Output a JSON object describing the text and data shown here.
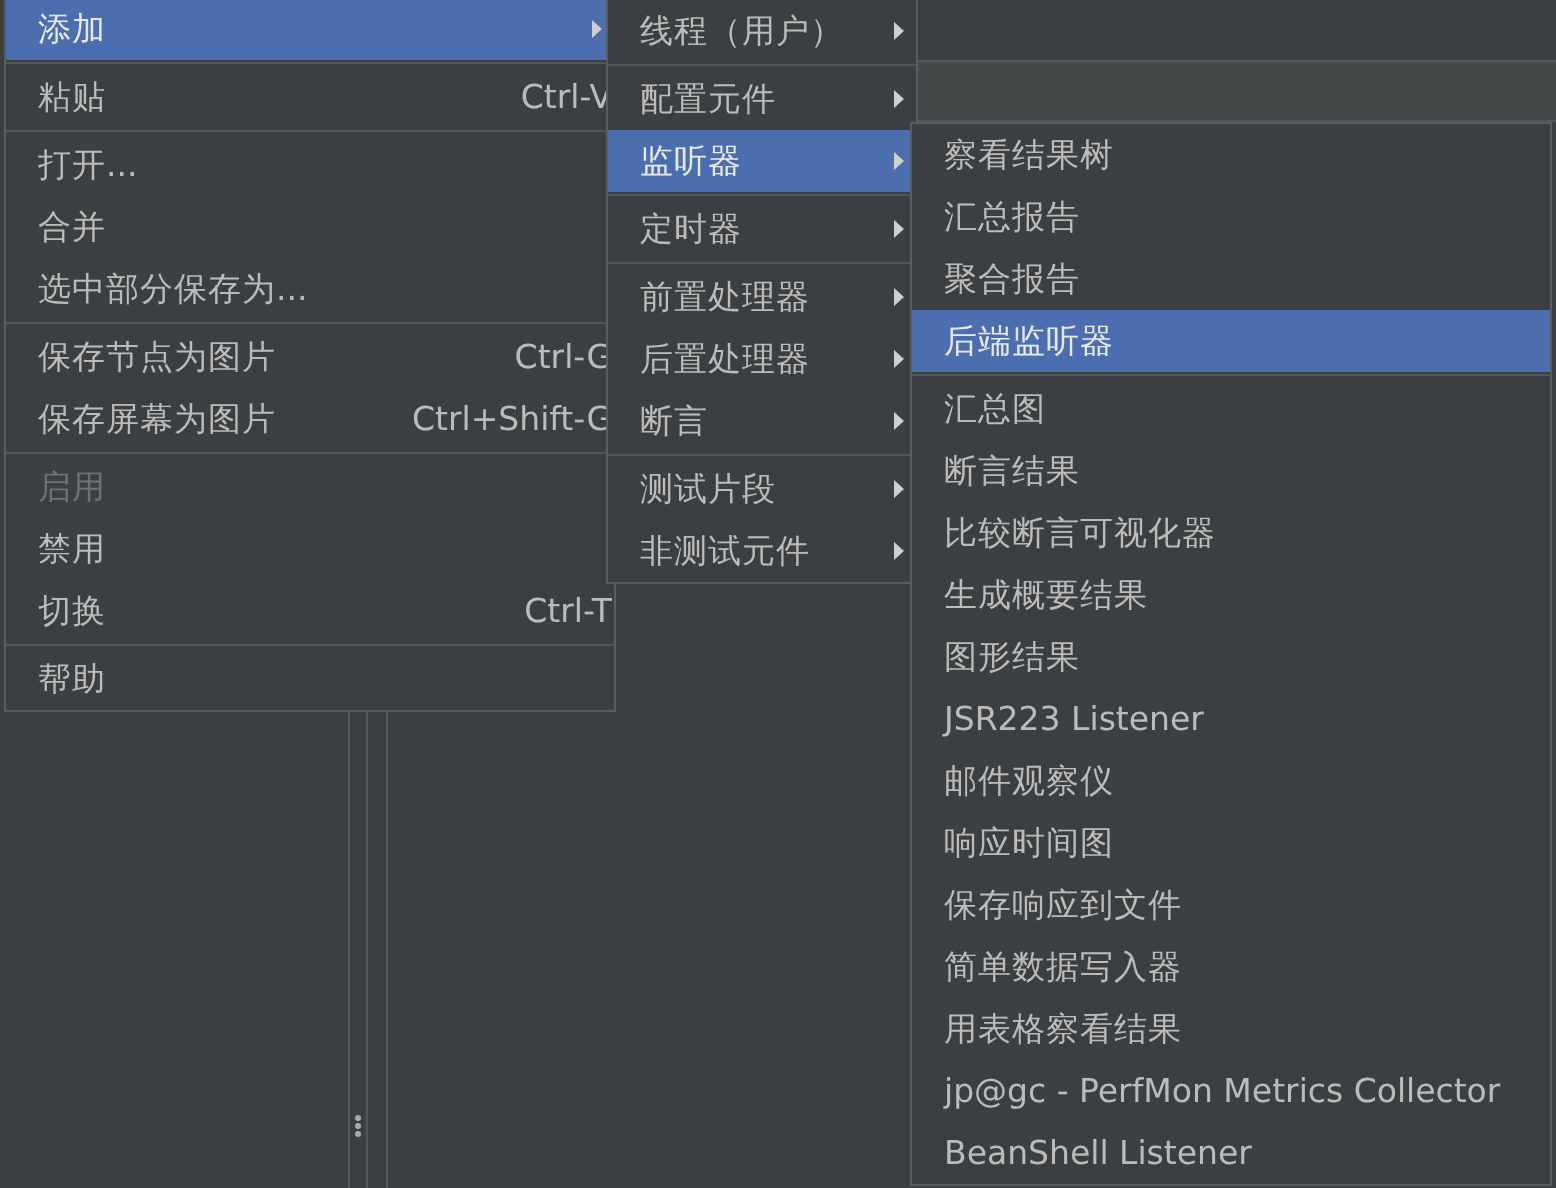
{
  "menus": [
    {
      "groups": [
        [
          {
            "label": "添加",
            "has_submenu": true,
            "selected": true,
            "disabled": false
          }
        ],
        [
          {
            "label": "粘贴",
            "shortcut": "Ctrl-V",
            "has_submenu": false,
            "selected": false,
            "disabled": false
          }
        ],
        [
          {
            "label": "打开...",
            "has_submenu": false,
            "selected": false,
            "disabled": false
          },
          {
            "label": "合并",
            "has_submenu": false,
            "selected": false,
            "disabled": false
          },
          {
            "label": "选中部分保存为...",
            "has_submenu": false,
            "selected": false,
            "disabled": false
          }
        ],
        [
          {
            "label": "保存节点为图片",
            "shortcut": "Ctrl-G",
            "has_submenu": false,
            "selected": false,
            "disabled": false
          },
          {
            "label": "保存屏幕为图片",
            "shortcut": "Ctrl+Shift-G",
            "has_submenu": false,
            "selected": false,
            "disabled": false
          }
        ],
        [
          {
            "label": "启用",
            "has_submenu": false,
            "selected": false,
            "disabled": true
          },
          {
            "label": "禁用",
            "has_submenu": false,
            "selected": false,
            "disabled": false
          },
          {
            "label": "切换",
            "shortcut": "Ctrl-T",
            "has_submenu": false,
            "selected": false,
            "disabled": false
          }
        ],
        [
          {
            "label": "帮助",
            "has_submenu": false,
            "selected": false,
            "disabled": false
          }
        ]
      ]
    },
    {
      "groups": [
        [
          {
            "label": "线程（用户）",
            "has_submenu": true,
            "selected": false
          }
        ],
        [
          {
            "label": "配置元件",
            "has_submenu": true,
            "selected": false
          },
          {
            "label": "监听器",
            "has_submenu": true,
            "selected": true
          }
        ],
        [
          {
            "label": "定时器",
            "has_submenu": true,
            "selected": false
          }
        ],
        [
          {
            "label": "前置处理器",
            "has_submenu": true,
            "selected": false
          },
          {
            "label": "后置处理器",
            "has_submenu": true,
            "selected": false
          },
          {
            "label": "断言",
            "has_submenu": true,
            "selected": false
          }
        ],
        [
          {
            "label": "测试片段",
            "has_submenu": true,
            "selected": false
          },
          {
            "label": "非测试元件",
            "has_submenu": true,
            "selected": false
          }
        ]
      ]
    },
    {
      "groups": [
        [
          {
            "label": "察看结果树",
            "selected": false
          },
          {
            "label": "汇总报告",
            "selected": false
          },
          {
            "label": "聚合报告",
            "selected": false
          },
          {
            "label": "后端监听器",
            "selected": true
          }
        ],
        [
          {
            "label": "汇总图",
            "selected": false
          },
          {
            "label": "断言结果",
            "selected": false
          },
          {
            "label": "比较断言可视化器",
            "selected": false
          },
          {
            "label": "生成概要结果",
            "selected": false
          },
          {
            "label": "图形结果",
            "selected": false
          },
          {
            "label": "JSR223 Listener",
            "selected": false
          },
          {
            "label": "邮件观察仪",
            "selected": false
          },
          {
            "label": "响应时间图",
            "selected": false
          },
          {
            "label": "保存响应到文件",
            "selected": false
          },
          {
            "label": "简单数据写入器",
            "selected": false
          },
          {
            "label": "用表格察看结果",
            "selected": false
          },
          {
            "label": "jp@gc - PerfMon Metrics Collector",
            "selected": false
          },
          {
            "label": "BeanShell Listener",
            "selected": false
          }
        ]
      ]
    }
  ]
}
